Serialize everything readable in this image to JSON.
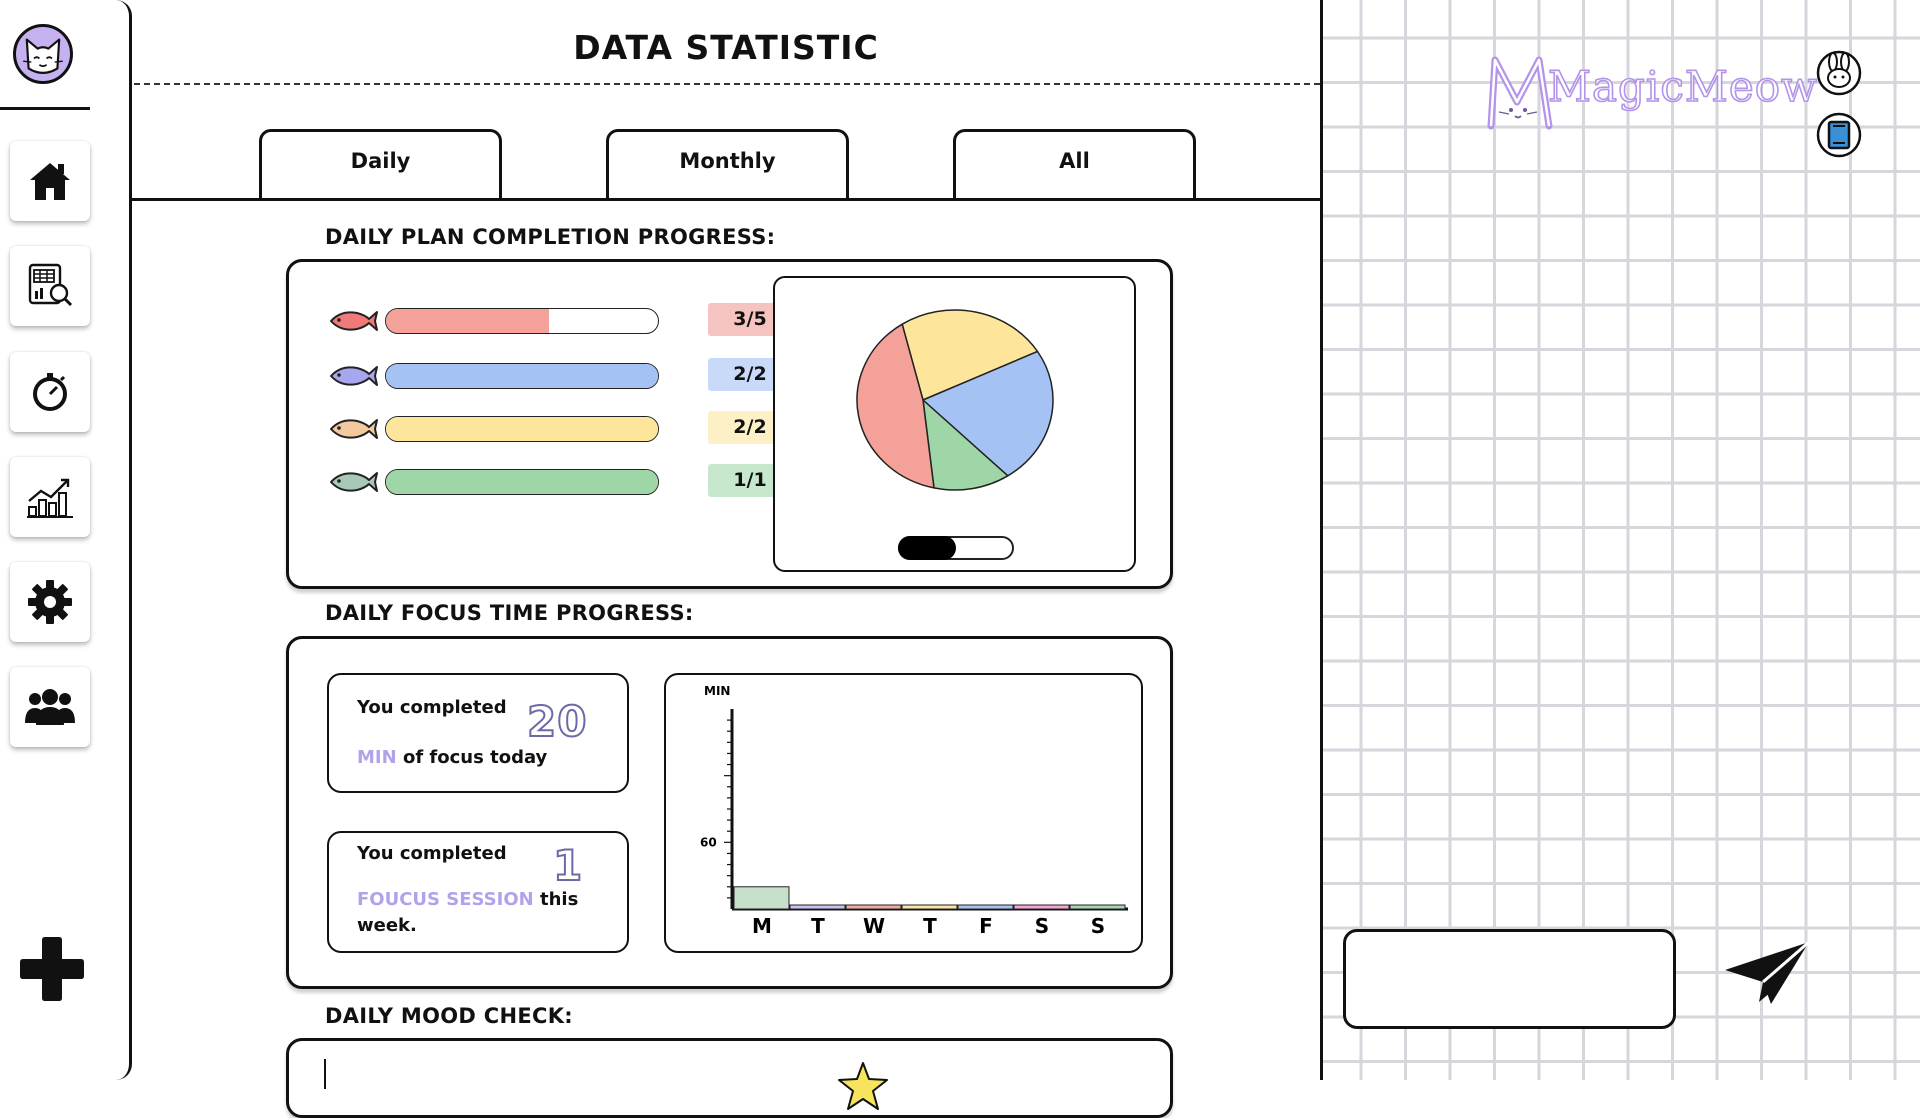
{
  "app": {
    "title": "DATA STATISTIC",
    "brand": "MagicMeow"
  },
  "sidebar": {
    "avatar_icon": "cat-face-avatar",
    "items": [
      {
        "icon": "home-icon"
      },
      {
        "icon": "planner-report-icon"
      },
      {
        "icon": "stopwatch-icon"
      },
      {
        "icon": "growth-chart-icon"
      },
      {
        "icon": "gear-icon"
      },
      {
        "icon": "group-icon"
      }
    ],
    "add_icon": "plus-icon"
  },
  "tabs": [
    {
      "label": "Daily"
    },
    {
      "label": "Monthly"
    },
    {
      "label": "All"
    }
  ],
  "plan_progress": {
    "heading": "DAILY PLAN COMPLETION PROGRESS:",
    "rows": [
      {
        "count": "3/5",
        "done": 3,
        "total": 5,
        "color": "#f4a199",
        "badge_bg": "#f6c4c0",
        "fish_color": "#f07a7a"
      },
      {
        "count": "2/2",
        "done": 2,
        "total": 2,
        "color": "#a5c2f4",
        "badge_bg": "#c9daf8",
        "fish_color": "#a9a6f0"
      },
      {
        "count": "2/2",
        "done": 2,
        "total": 2,
        "color": "#fde69c",
        "badge_bg": "#fdf0c6",
        "fish_color": "#f3c99f"
      },
      {
        "count": "1/1",
        "done": 1,
        "total": 1,
        "color": "#9fd6a8",
        "badge_bg": "#c7e8cc",
        "fish_color": "#a9c9b8"
      }
    ],
    "pie_toggle_on": true
  },
  "chart_data": {
    "type": "pie",
    "slices": [
      {
        "value": 3,
        "color": "#f4a199"
      },
      {
        "value": 2,
        "color": "#fde69c"
      },
      {
        "value": 2,
        "color": "#a5c2f4"
      },
      {
        "value": 1,
        "color": "#9fd6a8"
      }
    ]
  },
  "focus": {
    "heading": "DAILY FOCUS TIME PROGRESS:",
    "today": {
      "prefix": "You completed",
      "value": "20",
      "unit": "MIN",
      "suffix": "of focus today"
    },
    "week": {
      "prefix": "You completed",
      "value": "1",
      "unit": "FOUCUS SESSION",
      "suffix": "this",
      "suffix2": "week."
    },
    "bar_chart": {
      "type": "bar",
      "ylabel": "MIN",
      "ytick": "60",
      "ymax_units": 180,
      "categories": [
        "M",
        "T",
        "W",
        "T",
        "F",
        "S",
        "S"
      ],
      "values": [
        20,
        0,
        0,
        0,
        0,
        0,
        0
      ],
      "colors": [
        "#c7e0cc",
        "#c9c1f2",
        "#f3a9a6",
        "#fbe6a6",
        "#a9c4f2",
        "#f4a8d8",
        "#a9d4b0"
      ]
    }
  },
  "mood": {
    "heading": "DAILY MOOD CHECK:",
    "star_color": "#f7e45c"
  },
  "right_panel": {
    "bunny_icon": "bunny-icon",
    "book_icon": "book-icon",
    "send_icon": "paper-plane-icon",
    "input_value": ""
  }
}
